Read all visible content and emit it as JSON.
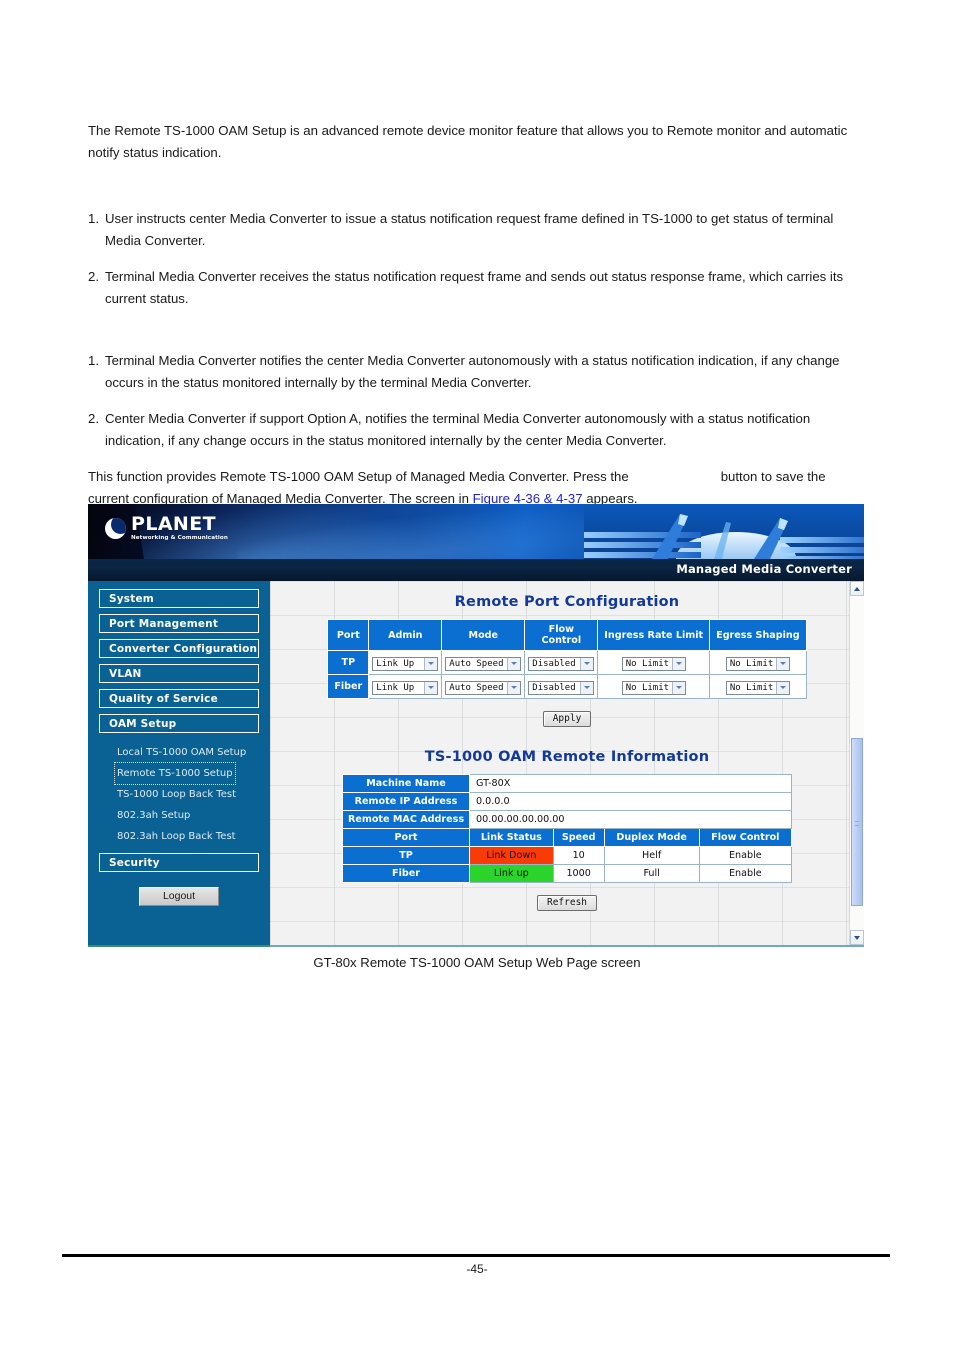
{
  "document": {
    "intro": "The Remote TS-1000 OAM Setup is an advanced remote device monitor feature that allows you to Remote monitor and automatic notify status indication.",
    "list_one": [
      {
        "num": "1.",
        "text": "User instructs center Media Converter to issue a status notification request frame defined in TS-1000 to get status of terminal Media Converter."
      },
      {
        "num": "2.",
        "text": "Terminal Media Converter receives the status notification request frame and sends out status response frame, which carries its current status."
      }
    ],
    "list_two": [
      {
        "num": "1.",
        "text": "Terminal Media Converter notifies the center Media Converter autonomously with a status notification indication, if any change occurs in the status monitored internally by the terminal Media Converter."
      },
      {
        "num": "2.",
        "text": "Center Media Converter if support Option A, notifies the terminal Media Converter autonomously with a status notification indication, if any change occurs in the status monitored internally by the center Media Converter."
      }
    ],
    "closing_a": "This function provides Remote TS-1000 OAM Setup of Managed Media Converter. Press the",
    "closing_b": "button to save the current configuration of Managed Media Converter. The screen in",
    "figure_link": "Figure 4-36 & 4-37",
    "closing_c": "appears.",
    "caption": "GT-80x Remote TS-1000 OAM Setup Web Page screen",
    "page_number": "-45-"
  },
  "webui": {
    "brand": {
      "name": "PLANET",
      "tagline": "Networking & Communication"
    },
    "title_bar": "Managed Media Converter",
    "sidebar": {
      "buttons": [
        {
          "label": "System"
        },
        {
          "label": "Port Management"
        },
        {
          "label": "Converter Configuration"
        },
        {
          "label": "VLAN"
        },
        {
          "label": "Quality of Service"
        },
        {
          "label": "OAM Setup"
        }
      ],
      "sub_items": [
        {
          "label": "Local TS-1000 OAM Setup",
          "active": false
        },
        {
          "label": "Remote TS-1000 Setup",
          "active": true
        },
        {
          "label": "TS-1000 Loop Back Test",
          "active": false
        },
        {
          "label": "802.3ah Setup",
          "active": false
        },
        {
          "label": "802.3ah Loop Back Test",
          "active": false
        }
      ],
      "security_button": "Security",
      "logout_button": "Logout"
    },
    "port_config": {
      "title": "Remote Port Configuration",
      "headers": [
        "Port",
        "Admin",
        "Mode",
        "Flow Control",
        "Ingress Rate Limit",
        "Egress Shaping"
      ],
      "rows": [
        {
          "port": "TP",
          "admin": "Link Up",
          "mode": "Auto Speed",
          "flow_control": "Disabled",
          "ingress_rate_limit": "No Limit",
          "egress_shaping": "No Limit"
        },
        {
          "port": "Fiber",
          "admin": "Link Up",
          "mode": "Auto Speed",
          "flow_control": "Disabled",
          "ingress_rate_limit": "No Limit",
          "egress_shaping": "No Limit"
        }
      ],
      "apply_button": "Apply"
    },
    "remote_info": {
      "title": "TS-1000 OAM Remote Information",
      "machine_name_label": "Machine Name",
      "machine_name_value": "GT-80X",
      "remote_ip_label": "Remote IP Address",
      "remote_ip_value": "0.0.0.0",
      "remote_mac_label": "Remote MAC Address",
      "remote_mac_value": "00.00.00.00.00.00",
      "headers": [
        "Port",
        "Link Status",
        "Speed",
        "Duplex Mode",
        "Flow Control"
      ],
      "rows": [
        {
          "port": "TP",
          "link_status": "Link Down",
          "speed": "10",
          "duplex": "Helf",
          "flow_control": "Enable"
        },
        {
          "port": "Fiber",
          "link_status": "Link up",
          "speed": "1000",
          "duplex": "Full",
          "flow_control": "Enable"
        }
      ],
      "refresh_button": "Refresh"
    },
    "colors": {
      "sidebar_blue": "#0a6294",
      "table_header_blue": "#0a6fd0",
      "title_navy": "#14399c",
      "link_down_red": "#f93b06",
      "link_up_green": "#2bd42b",
      "doc_link_blue": "#2020dd"
    }
  }
}
